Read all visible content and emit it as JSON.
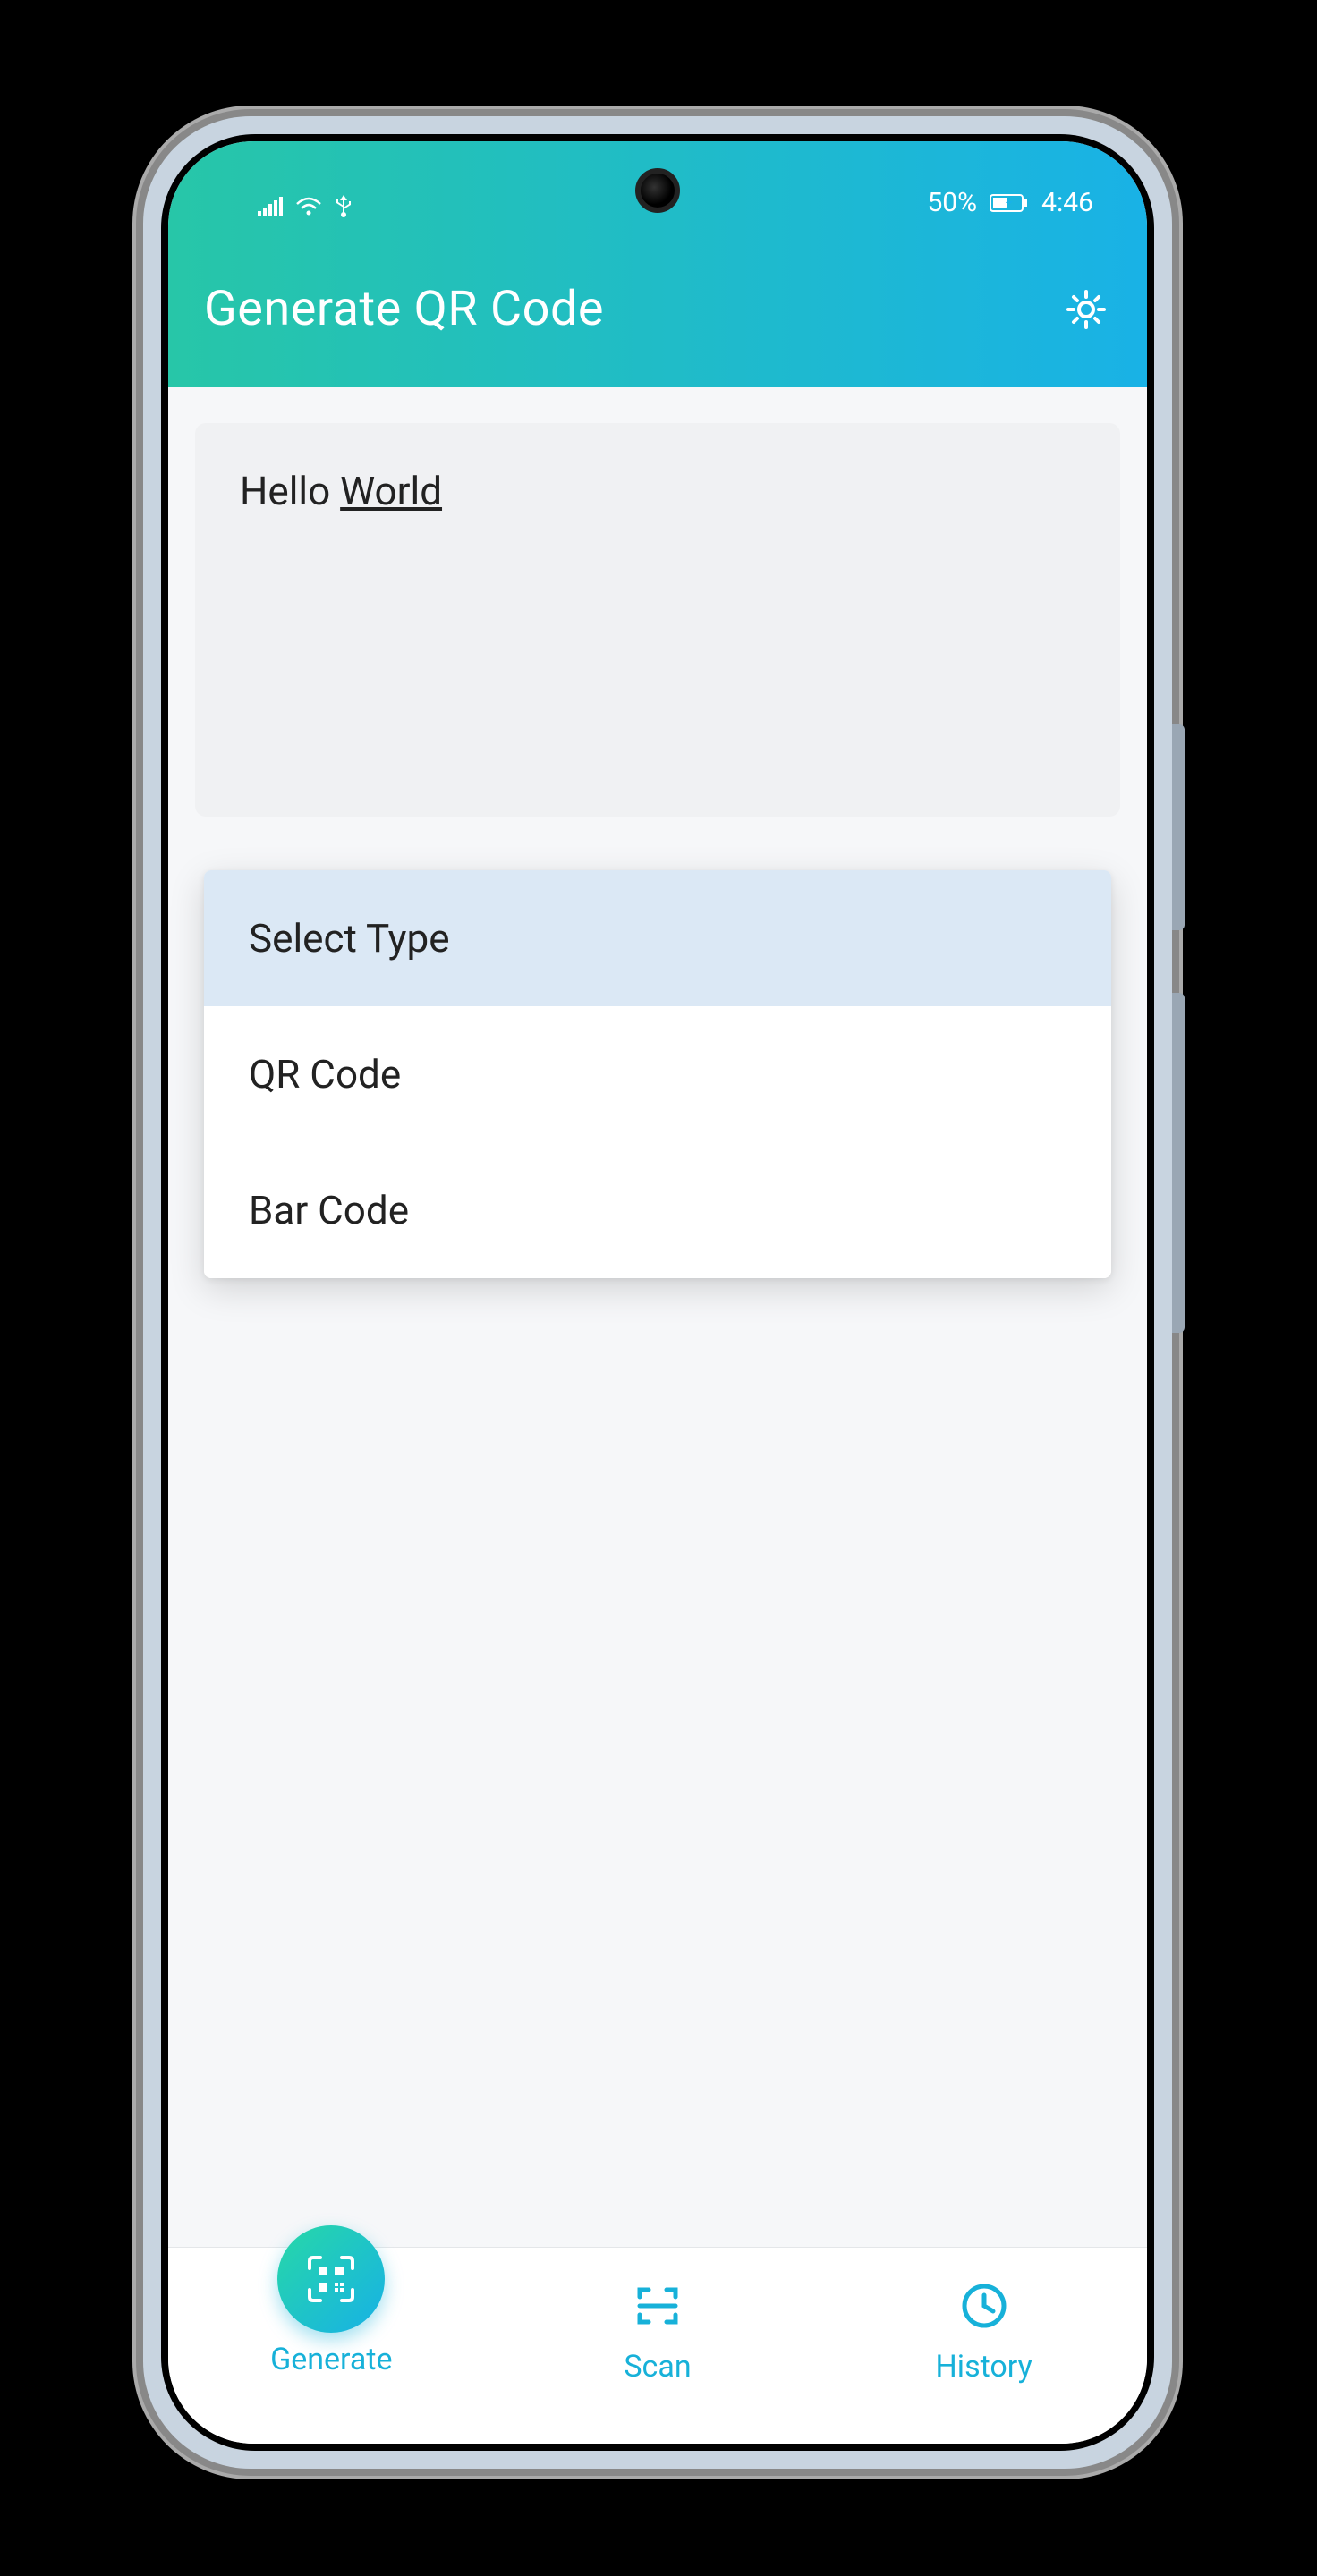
{
  "statusbar": {
    "battery_pct": "50%",
    "time": "4:46"
  },
  "header": {
    "title": "Generate QR Code"
  },
  "input": {
    "text_part1": "Hello ",
    "text_part2": "World"
  },
  "dropdown": {
    "placeholder": "Select Type",
    "options": [
      "QR Code",
      "Bar Code"
    ]
  },
  "nav": {
    "generate": "Generate",
    "scan": "Scan",
    "history": "History"
  },
  "colors": {
    "gradient_start": "#27c6a8",
    "gradient_end": "#19b2e6",
    "accent": "#17b1d9"
  }
}
